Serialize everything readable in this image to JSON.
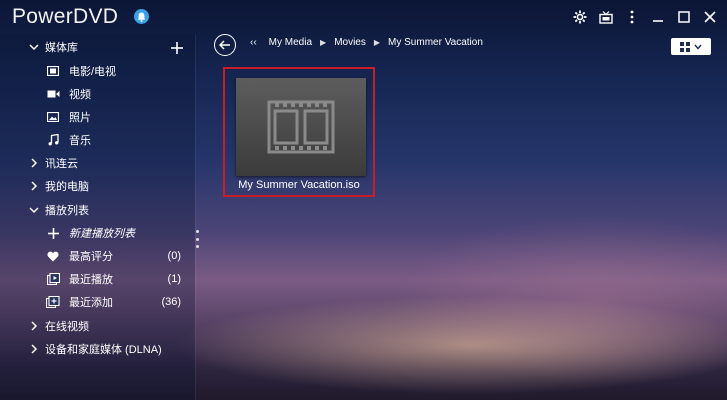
{
  "app": {
    "title": "PowerDVD"
  },
  "window_controls": [
    "settings-icon",
    "tv-mode-icon",
    "more-icon",
    "minimize-icon",
    "maximize-icon",
    "close-icon"
  ],
  "sidebar": {
    "media_library": {
      "label": "媒体库",
      "items": [
        {
          "icon": "film-icon",
          "label": "电影/电视"
        },
        {
          "icon": "video-icon",
          "label": "视频"
        },
        {
          "icon": "photo-icon",
          "label": "照片"
        },
        {
          "icon": "music-icon",
          "label": "音乐"
        }
      ]
    },
    "cloud": {
      "label": "讯连云"
    },
    "my_computer": {
      "label": "我的电脑"
    },
    "playlists": {
      "label": "播放列表",
      "items": [
        {
          "icon": "plus-icon",
          "label": "新建播放列表",
          "count": ""
        },
        {
          "icon": "heart-icon",
          "label": "最高评分",
          "count": "(0)"
        },
        {
          "icon": "recent-play-icon",
          "label": "最近播放",
          "count": "(1)"
        },
        {
          "icon": "recent-add-icon",
          "label": "最近添加",
          "count": "(36)"
        }
      ]
    },
    "online_video": {
      "label": "在线视频"
    },
    "dlna": {
      "label": "设备和家庭媒体 (DLNA)"
    }
  },
  "breadcrumb": [
    "My Media",
    "Movies",
    "My Summer Vacation"
  ],
  "content": {
    "items": [
      {
        "label": "My Summer Vacation.iso",
        "selected": true
      }
    ]
  },
  "colors": {
    "selection_border": "#c81e2a",
    "bell": "#3aa0e8"
  }
}
